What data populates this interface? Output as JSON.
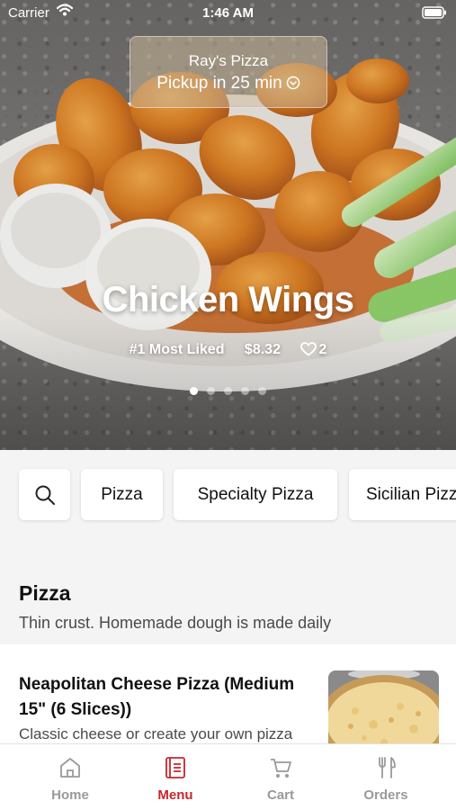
{
  "status_bar": {
    "carrier": "Carrier",
    "time": "1:46 AM",
    "wifi_icon": "wifi-icon",
    "battery_icon": "battery-icon"
  },
  "store": {
    "name": "Ray's Pizza",
    "pickup": "Pickup in 25 min",
    "chevron_icon": "chevron-down-circle-icon"
  },
  "hero": {
    "title": "Chicken Wings",
    "badge": "#1 Most Liked",
    "price": "$8.32",
    "likes": "2",
    "heart_icon": "heart-icon",
    "slide_count": 5,
    "active_slide": 1
  },
  "categories": {
    "search_icon": "search-icon",
    "items": [
      "Pizza",
      "Specialty Pizza",
      "Sicilian Pizza"
    ]
  },
  "section": {
    "title": "Pizza",
    "subtitle": "Thin crust. Homemade dough is made daily"
  },
  "menu_items": [
    {
      "name": "Neapolitan Cheese Pizza (Medium 15\" (6 Slices))",
      "description": "Classic cheese or create your own pizza"
    }
  ],
  "tabs": [
    {
      "label": "Home",
      "icon": "home-icon",
      "active": false
    },
    {
      "label": "Menu",
      "icon": "menu-book-icon",
      "active": true
    },
    {
      "label": "Cart",
      "icon": "cart-icon",
      "active": false
    },
    {
      "label": "Orders",
      "icon": "utensils-icon",
      "active": false
    }
  ],
  "colors": {
    "accent": "#c9252c",
    "tab_inactive": "#9a9a9a",
    "background": "#f4f4f4"
  }
}
